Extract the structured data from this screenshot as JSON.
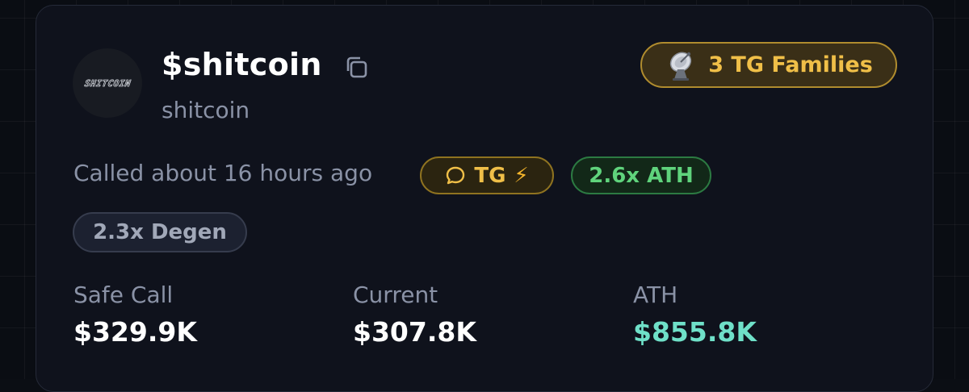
{
  "token": {
    "avatar_text": "SHITCOIN",
    "ticker": "$shitcoin",
    "name": "shitcoin",
    "copy_icon": "copy-icon"
  },
  "families_badge": {
    "icon": "satellite-dish-icon",
    "label": "3 TG Families",
    "color": "#f0bf48"
  },
  "call": {
    "called_text": "Called about 16 hours ago",
    "tg_badge": {
      "icon": "chat-bubble-icon",
      "label": "TG",
      "bolt": "⚡"
    },
    "ath_badge": {
      "label": "2.6x ATH",
      "color": "#5fd37c"
    },
    "degen_badge": {
      "label": "2.3x Degen"
    }
  },
  "stats": [
    {
      "label": "Safe Call",
      "value": "$329.9K"
    },
    {
      "label": "Current",
      "value": "$307.8K"
    },
    {
      "label": "ATH",
      "value": "$855.8K",
      "color": "#6fe0c8"
    }
  ]
}
